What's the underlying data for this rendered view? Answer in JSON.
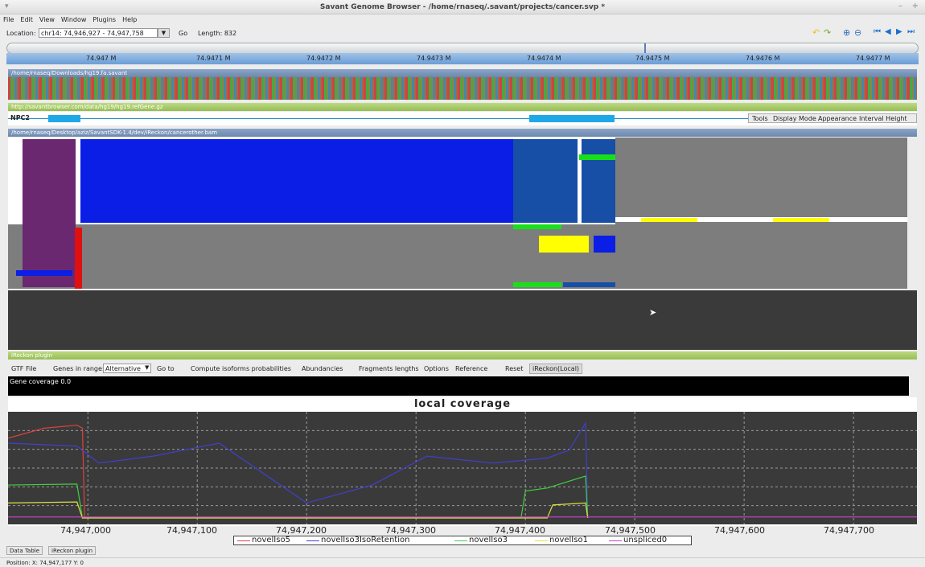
{
  "window": {
    "title": "Savant Genome Browser - /home/rnaseq/.savant/projects/cancer.svp *"
  },
  "menu": [
    "File",
    "Edit",
    "View",
    "Window",
    "Plugins",
    "Help"
  ],
  "toolbar": {
    "location_label": "Location:",
    "location_value": "chr14: 74,946,927 - 74,947,758",
    "go_label": "Go",
    "length_label": "Length: 832"
  },
  "ruler_ticks": [
    "74.947 M",
    "74.9471 M",
    "74.9472 M",
    "74.9473 M",
    "74.9474 M",
    "74.9475 M",
    "74.9476 M",
    "74.9477 M"
  ],
  "tracks": {
    "seq": "/home/rnaseq/Downloads/hg19.fa.savant",
    "refgene": "http://savantbrowser.com/data/hg19/hg19.refGene.gz",
    "bam": "/home/rnaseq/Desktop/aziz/SavantSDK-1.4/dev/iReckon/cancerother.bam"
  },
  "gene_label": "NPC2",
  "track_menu": [
    "Tools",
    "Display Mode",
    "Appearance",
    "Interval Height"
  ],
  "plugin": {
    "title": "iReckon plugin",
    "menu": [
      "GTF File",
      "Genes in range:",
      "Alternative",
      "Go to",
      "Compute isoforms probabilities",
      "Abundancies",
      "Fragments lengths",
      "Options",
      "Reference",
      "Reset",
      "iReckon(Local)"
    ],
    "coverage_text": "Gene coverage 0.0"
  },
  "chart_data": {
    "type": "line",
    "title": "local coverage",
    "x_ticks": [
      "74,947,000",
      "74,947,100",
      "74,947,200",
      "74,947,300",
      "74,947,400",
      "74,947,500",
      "74,947,600",
      "74,947,700"
    ],
    "xlim": [
      74946927,
      74947758
    ],
    "series": [
      {
        "name": "novelIso5",
        "color": "#e04040",
        "x": [
          74946927,
          74946960,
          74946990,
          74946995,
          74946997
        ],
        "y": [
          0.8,
          0.9,
          0.93,
          0.9,
          0.0
        ]
      },
      {
        "name": "novelIso3IsoRetention",
        "color": "#4040d0",
        "x": [
          74946927,
          74946990,
          74947010,
          74947060,
          74947120,
          74947160,
          74947200,
          74947260,
          74947310,
          74947370,
          74947420,
          74947440,
          74947455,
          74947457
        ],
        "y": [
          0.75,
          0.72,
          0.55,
          0.62,
          0.75,
          0.45,
          0.15,
          0.33,
          0.62,
          0.55,
          0.6,
          0.68,
          0.95,
          0.0
        ]
      },
      {
        "name": "novelIso3",
        "color": "#40d040",
        "x": [
          74946927,
          74946990,
          74946995,
          74947396,
          74947400,
          74947420,
          74947455,
          74947457
        ],
        "y": [
          0.33,
          0.34,
          0.0,
          0.0,
          0.27,
          0.3,
          0.42,
          0.0
        ]
      },
      {
        "name": "novelIso1",
        "color": "#e0e040",
        "x": [
          74946927,
          74946990,
          74946995,
          74947420,
          74947425,
          74947455,
          74947457
        ],
        "y": [
          0.15,
          0.16,
          0.0,
          0.0,
          0.13,
          0.15,
          0.0
        ]
      },
      {
        "name": "unspliced0",
        "color": "#c040c0",
        "x": [
          74946927,
          74947758
        ],
        "y": [
          0.01,
          0.01
        ]
      }
    ]
  },
  "bottom_tabs": [
    "Data Table",
    "iReckon plugin"
  ],
  "status": "Position: X: 74,947,177 Y: 0",
  "colors": {
    "read_blue": "#0a1ee6",
    "read_dark": "#174fa6",
    "read_purple": "#6a2870",
    "track_gray": "#7d7d7d",
    "snp_yellow": "#ffff00",
    "green": "#18e018"
  }
}
